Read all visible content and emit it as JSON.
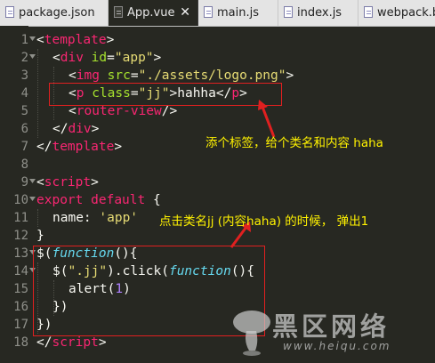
{
  "tabs": [
    {
      "label": "package.json",
      "active": false
    },
    {
      "label": "App.vue",
      "active": true,
      "close": "✕"
    },
    {
      "label": "main.js",
      "active": false
    },
    {
      "label": "index.js",
      "active": false
    },
    {
      "label": "webpack.b",
      "active": false
    }
  ],
  "line_numbers": [
    "1",
    "2",
    "3",
    "4",
    "5",
    "6",
    "7",
    "8",
    "9",
    "10",
    "11",
    "12",
    "13",
    "14",
    "15",
    "16",
    "17",
    "18"
  ],
  "code": {
    "l1": {
      "p1": "<",
      "p2": "template",
      "p3": ">"
    },
    "l2": {
      "p1": "<",
      "p2": "div",
      "p3": "id",
      "p4": "=",
      "p5": "\"app\"",
      "p6": ">"
    },
    "l3": {
      "p1": "<",
      "p2": "img",
      "p3": "src",
      "p4": "=",
      "p5": "\"./assets/logo.png\"",
      "p6": ">"
    },
    "l4": {
      "p1": "<",
      "p2": "p",
      "p3": "class",
      "p4": "=",
      "p5": "\"jj\"",
      "p6": ">hahha</",
      "p7": "p",
      "p8": ">"
    },
    "l5": {
      "p1": "<",
      "p2": "router-view",
      "p3": "/>"
    },
    "l6": {
      "p1": "</",
      "p2": "div",
      "p3": ">"
    },
    "l7": {
      "p1": "</",
      "p2": "template",
      "p3": ">"
    },
    "l9": {
      "p1": "<",
      "p2": "script",
      "p3": ">"
    },
    "l10": {
      "p1": "export",
      "p2": "default",
      "p3": "{"
    },
    "l11": {
      "p1": "name:",
      "p2": "'app'"
    },
    "l12": {
      "p1": "}"
    },
    "l13": {
      "p1": "$(",
      "p2": "function",
      "p3": "(){"
    },
    "l14": {
      "p1": "$(",
      "p2": "\".jj\"",
      "p3": ").click(",
      "p4": "function",
      "p5": "(){"
    },
    "l15": {
      "p1": "alert(",
      "p2": "1",
      "p3": ")"
    },
    "l16": {
      "p1": "})"
    },
    "l17": {
      "p1": "})"
    },
    "l18": {
      "p1": "</",
      "p2": "script",
      "p3": ">"
    }
  },
  "annotations": {
    "note1": "添个标签，给个类名和内容 haha",
    "note2": "点击类名jj (内容haha) 的时候，  弹出1"
  },
  "watermark": {
    "text": "黑区网络",
    "url": "www.heiqu.com"
  },
  "colors": {
    "background": "#272822",
    "tag": "#f92672",
    "attribute": "#a6e22e",
    "string": "#e6db74",
    "function": "#66d9ef",
    "number": "#ae81ff",
    "annotation_text": "#fff200",
    "annotation_box": "#e02020"
  }
}
